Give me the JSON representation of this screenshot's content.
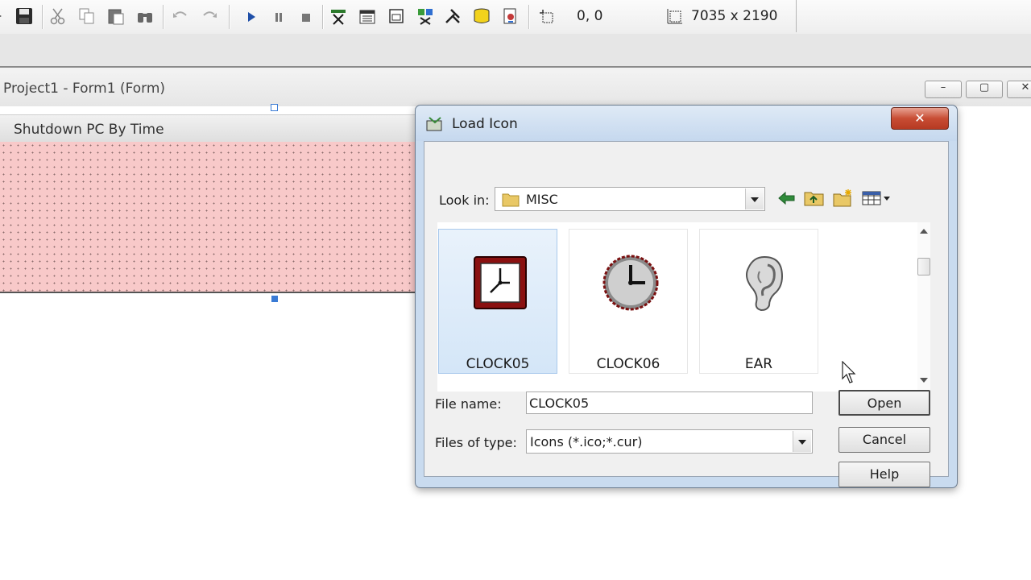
{
  "toolbar": {
    "cursor_pos": "0, 0",
    "form_size": "7035 x 2190",
    "icons": [
      "save-icon",
      "cut-icon",
      "copy-icon",
      "paste-icon",
      "find-icon",
      "undo-icon",
      "redo-icon",
      "run-icon",
      "pause-icon",
      "stop-icon",
      "project-explorer-icon",
      "properties-icon",
      "form-layout-icon",
      "object-browser-icon",
      "toolbox-icon",
      "data-view-icon",
      "component-manager-icon",
      "position-icon",
      "size-icon"
    ]
  },
  "project_window": {
    "title": "Project1 - Form1 (Form)",
    "controls": [
      "–",
      "▢",
      "✕"
    ]
  },
  "form": {
    "caption": "Shutdown PC By Time",
    "back_color": "#f8c9c9"
  },
  "dialog": {
    "title": "Load Icon",
    "close_label": "✕",
    "look_in_label": "Look in:",
    "look_in_value": "MISC",
    "items": [
      {
        "name": "CLOCK05",
        "icon": "clock-square-red-icon",
        "selected": true
      },
      {
        "name": "CLOCK06",
        "icon": "clock-round-icon",
        "selected": false
      },
      {
        "name": "EAR",
        "icon": "ear-icon",
        "selected": false
      }
    ],
    "file_name_label": "File name:",
    "file_name_value": "CLOCK05",
    "files_of_type_label": "Files of type:",
    "files_of_type_value": "Icons (*.ico;*.cur)",
    "buttons": {
      "open": "Open",
      "cancel": "Cancel",
      "help": "Help"
    }
  },
  "colors": {
    "dialog_frame": "#c9dbef",
    "selection": "#d4e6f8",
    "close_button": "#c84d34"
  }
}
